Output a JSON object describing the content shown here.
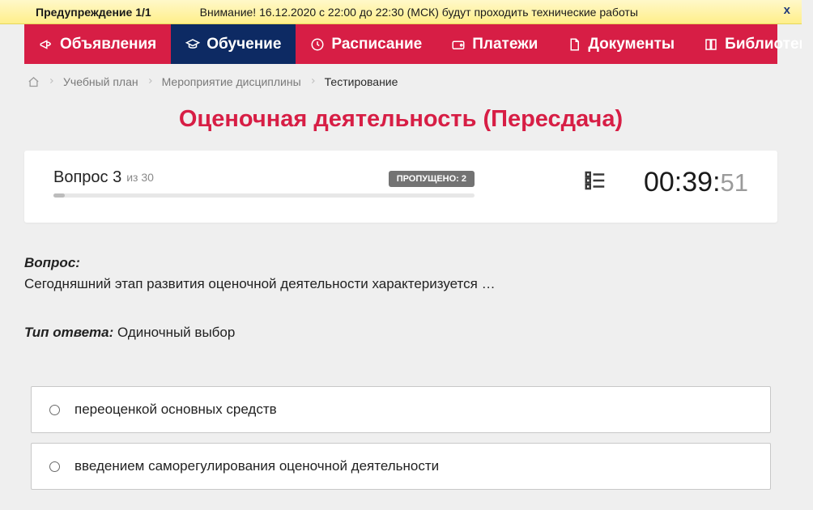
{
  "warning": {
    "title": "Предупреждение 1/1",
    "message": "Внимание! 16.12.2020 с 22:00 до 22:30 (МСК) будут проходить технические работы",
    "close": "x"
  },
  "nav": {
    "items": [
      {
        "label": "Объявления",
        "icon": "megaphone"
      },
      {
        "label": "Обучение",
        "icon": "graduation-cap",
        "active": true
      },
      {
        "label": "Расписание",
        "icon": "clock"
      },
      {
        "label": "Платежи",
        "icon": "wallet"
      },
      {
        "label": "Документы",
        "icon": "document"
      },
      {
        "label": "Библиотека",
        "icon": "book",
        "caret": true
      }
    ]
  },
  "breadcrumbs": {
    "items": [
      {
        "label": "Учебный план"
      },
      {
        "label": "Мероприятие дисциплины"
      }
    ],
    "current": "Тестирование"
  },
  "page_title": "Оценочная деятельность (Пересдача)",
  "progress": {
    "question_label": "Вопрос 3",
    "total_label": "из 30",
    "skipped_label": "ПРОПУЩЕНО: 2"
  },
  "timer": {
    "main": "00:39:",
    "seconds": "51"
  },
  "question": {
    "label": "Вопрос:",
    "text": "Сегодняшний этап развития оценочной деятельности характеризуется …"
  },
  "answer_type": {
    "label": "Тип ответа:",
    "value": " Одиночный выбор"
  },
  "answers": [
    {
      "text": "переоценкой основных средств"
    },
    {
      "text": "введением саморегулирования оценочной деятельности"
    }
  ]
}
